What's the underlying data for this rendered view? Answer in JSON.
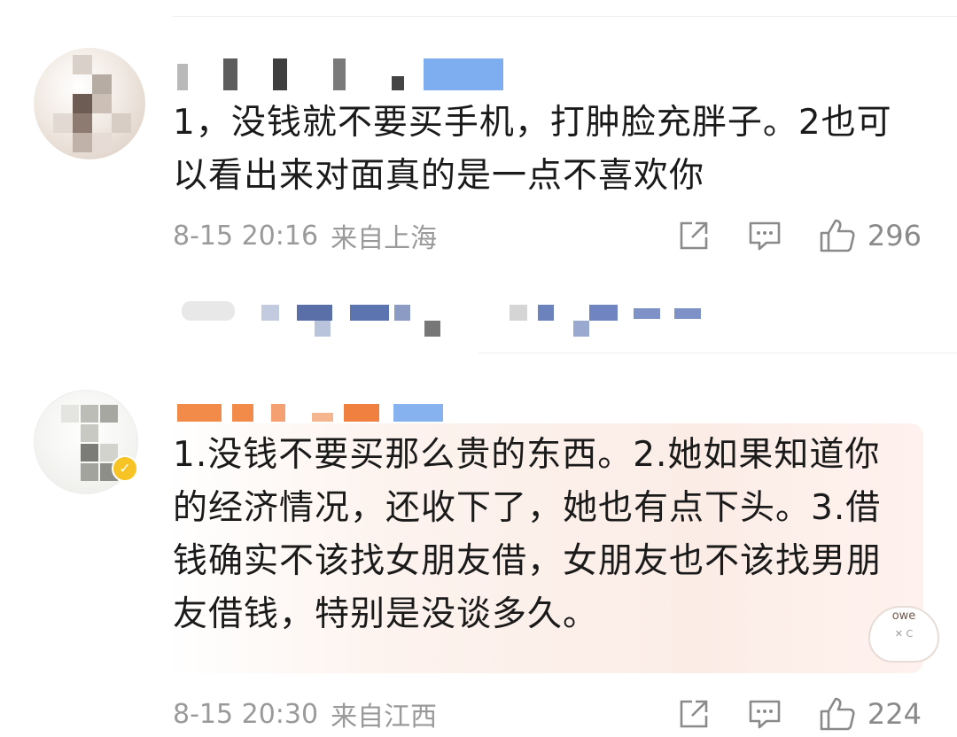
{
  "comments": [
    {
      "text": "1，没钱就不要买手机，打肿脸充胖子。2也可以看出来对面真的是一点不喜欢你",
      "time": "8-15 20:16",
      "location": "来自上海",
      "likes": "296"
    },
    {
      "text": "1.没钱不要买那么贵的东西。2.她如果知道你的经济情况，还收下了，她也有点下头。3.借钱确实不该找女朋友借，女朋友也不该找男朋友借钱，特别是没谈多久。",
      "time": "8-15 20:30",
      "location": "来自江西",
      "likes": "224",
      "verified": true,
      "sticker_text": "owe"
    }
  ],
  "colors": {
    "text": "#1a1a1a",
    "meta": "#9a9a9a",
    "like_count": "#8a8a8a",
    "name_orange": "#f07a3a",
    "name_blue": "#5b93e8",
    "verified_badge": "#f7c325",
    "highlight_bubble": "#fbece6"
  },
  "icons": {
    "share": "share-icon",
    "comment": "comment-icon",
    "like": "thumbs-up-icon",
    "verified": "verified-badge-icon"
  }
}
